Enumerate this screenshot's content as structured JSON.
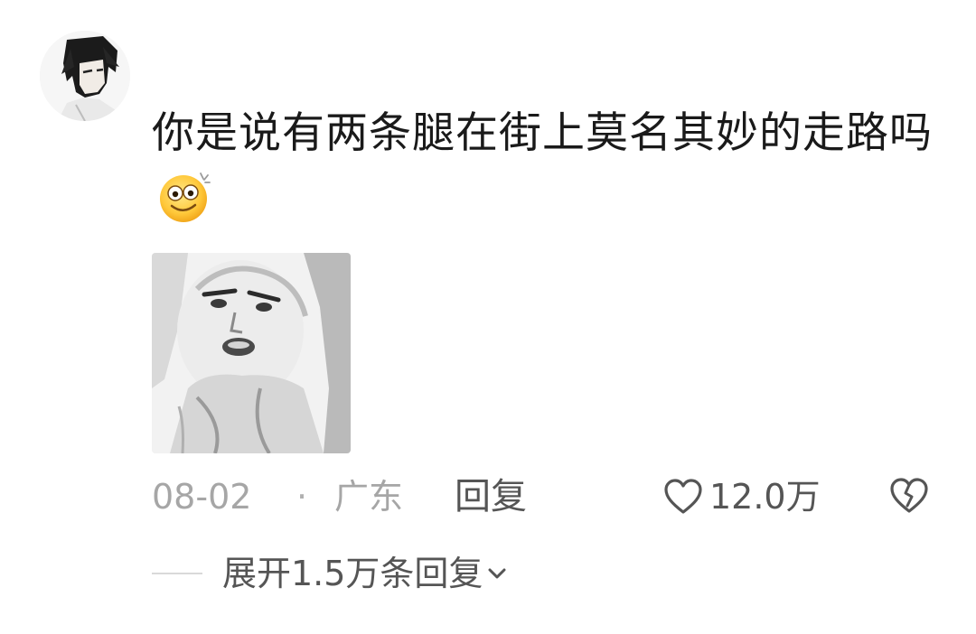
{
  "comment": {
    "text": "你是说有两条腿在街上莫名其妙的走路吗",
    "emoji": "dizzy-smile-emoji",
    "sticker": "meme-face-sticker"
  },
  "meta": {
    "date": "08-02",
    "separator": "·",
    "location": "广东",
    "reply_label": "回复"
  },
  "actions": {
    "like_count": "12.0万",
    "like_icon": "heart-outline-icon",
    "dislike_icon": "broken-heart-icon"
  },
  "replies": {
    "expand_label": "展开1.5万条回复"
  },
  "colors": {
    "text": "#1a1a1a",
    "meta": "#a6a6a6",
    "action": "#555555"
  }
}
